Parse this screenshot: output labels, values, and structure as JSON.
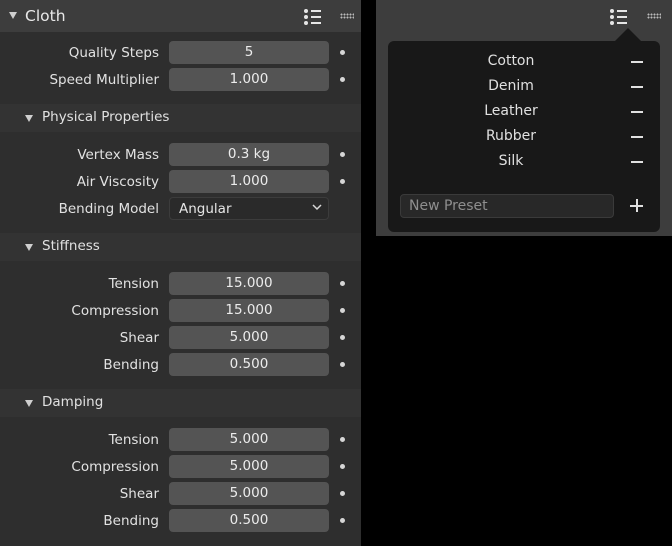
{
  "panel": {
    "title": "Cloth",
    "top_fields": [
      {
        "label": "Quality Steps",
        "value": "5"
      },
      {
        "label": "Speed Multiplier",
        "value": "1.000"
      }
    ],
    "physical": {
      "title": "Physical Properties",
      "fields": [
        {
          "label": "Vertex Mass",
          "value": "0.3 kg"
        },
        {
          "label": "Air Viscosity",
          "value": "1.000"
        }
      ],
      "bending_model": {
        "label": "Bending Model",
        "value": "Angular"
      }
    },
    "stiffness": {
      "title": "Stiffness",
      "fields": [
        {
          "label": "Tension",
          "value": "15.000"
        },
        {
          "label": "Compression",
          "value": "15.000"
        },
        {
          "label": "Shear",
          "value": "5.000"
        },
        {
          "label": "Bending",
          "value": "0.500"
        }
      ]
    },
    "damping": {
      "title": "Damping",
      "fields": [
        {
          "label": "Tension",
          "value": "5.000"
        },
        {
          "label": "Compression",
          "value": "5.000"
        },
        {
          "label": "Shear",
          "value": "5.000"
        },
        {
          "label": "Bending",
          "value": "0.500"
        }
      ]
    }
  },
  "presets": {
    "items": [
      "Cotton",
      "Denim",
      "Leather",
      "Rubber",
      "Silk"
    ],
    "new_preset_placeholder": "New Preset"
  },
  "icons": {
    "collapse": "triangle-down-icon",
    "presets": "preset-list-icon",
    "drag": "drag-grip-icon",
    "remove": "minus-icon",
    "add": "plus-icon",
    "dropdown": "chevron-down-icon"
  }
}
